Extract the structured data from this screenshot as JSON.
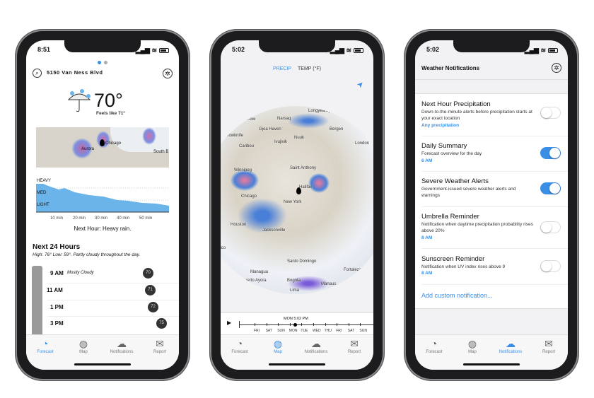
{
  "phones": [
    {
      "status_time": "8:51",
      "location_title": "5150 Van Ness Blvd",
      "temperature": "70°",
      "feels_like": "Feels like 71°",
      "map_labels": [
        "Chicago",
        "Aurora",
        "South B"
      ],
      "intensity_levels": [
        "HEAVY",
        "MED",
        "LIGHT"
      ],
      "minute_ticks": [
        "10 min",
        "20 min",
        "30 min",
        "40 min",
        "50 min"
      ],
      "next_hour_summary": "Next Hour: Heavy rain.",
      "next24_title": "Next 24 Hours",
      "next24_summary": "High: 76° Low: 59°. Partly cloudy throughout the day.",
      "hours": [
        {
          "time": "9 AM",
          "condition": "Mostly Cloudy",
          "temp": "70"
        },
        {
          "time": "11 AM",
          "condition": "",
          "temp": "71"
        },
        {
          "time": "1 PM",
          "condition": "",
          "temp": "72"
        },
        {
          "time": "3 PM",
          "condition": "",
          "temp": "75"
        }
      ],
      "active_tab": "Forecast"
    },
    {
      "status_time": "5:02",
      "segments": [
        "PRECIP",
        "TEMP (°F)"
      ],
      "active_segment": "PRECIP",
      "globe_labels": [
        "Longyearbyen",
        "Barrow",
        "Narsaq",
        "Anchorage",
        "Gjoa Haven",
        "Bergen",
        "Yellowknife",
        "Nuuk",
        "Caribou",
        "Ivujivik",
        "London",
        "Saint Anthony",
        "Winnipeg",
        "Halifax",
        "Chicago",
        "New York",
        "Houston",
        "Jacksonville",
        "Mexico",
        "Santo Domingo",
        "Managua",
        "Fortaleza",
        "Puerto Ayora",
        "Bogota",
        "Manaus",
        "Lima"
      ],
      "timeline_current": "MON   5:02 PM",
      "timeline_days": [
        "FRI",
        "SAT",
        "SUN",
        "MON",
        "TUE",
        "WED",
        "THU",
        "FRI",
        "SAT",
        "SUN"
      ],
      "active_tab": "Map"
    },
    {
      "status_time": "5:02",
      "title": "Weather Notifications",
      "notifications": [
        {
          "title": "Next Hour Precipitation",
          "description": "Down-to-the-minute alerts before precipitation starts at your exact location",
          "detail": "Any precipitation",
          "enabled": false
        },
        {
          "title": "Daily Summary",
          "description": "Forecast overview for the day",
          "detail": "6 AM",
          "enabled": true
        },
        {
          "title": "Severe Weather Alerts",
          "description": "Government-issued severe weather alerts and warnings",
          "detail": "",
          "enabled": true
        },
        {
          "title": "Umbrella Reminder",
          "description": "Notification when daytime precipitation probability rises above 20%",
          "detail": "8 AM",
          "enabled": false
        },
        {
          "title": "Sunscreen Reminder",
          "description": "Notification when UV index rises above 9",
          "detail": "8 AM",
          "enabled": false
        }
      ],
      "add_custom": "Add custom notification...",
      "active_tab": "Notifications"
    }
  ],
  "tabs": [
    {
      "label": "Forecast",
      "icon": "forecast-icon"
    },
    {
      "label": "Map",
      "icon": "globe-icon"
    },
    {
      "label": "Notifications",
      "icon": "notifications-icon"
    },
    {
      "label": "Report",
      "icon": "report-icon"
    }
  ],
  "colors": {
    "accent": "#3a8ee6",
    "precip_fill": "#6ab4ea",
    "toggle_on": "#3a8ee6"
  }
}
